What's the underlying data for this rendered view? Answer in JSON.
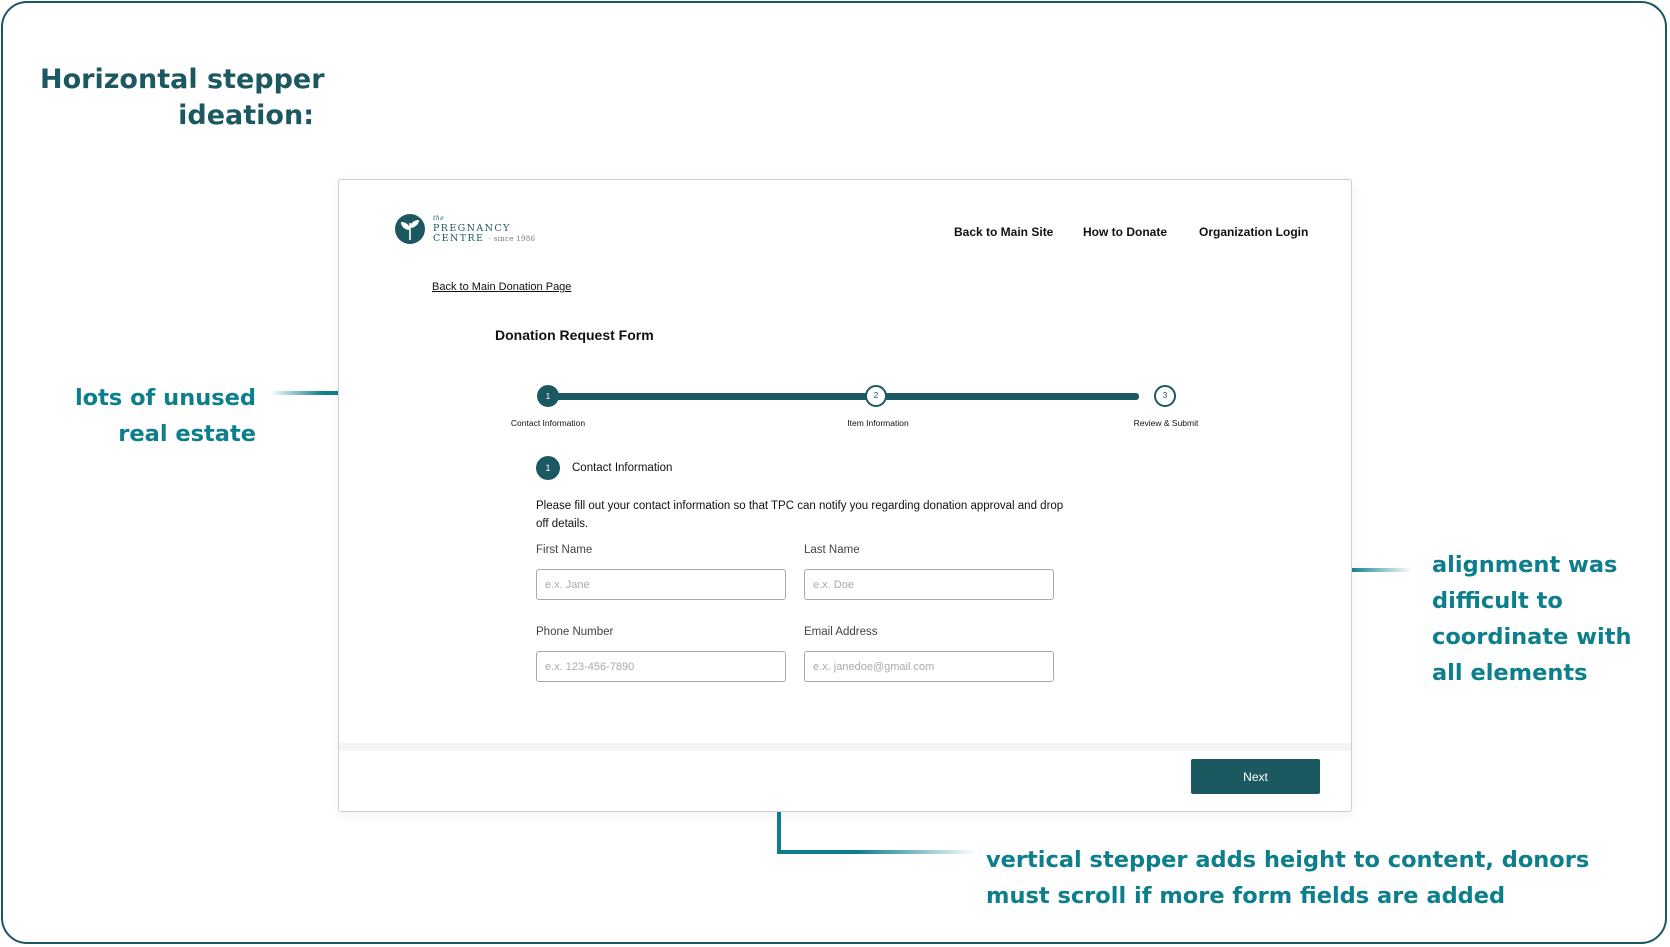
{
  "slide": {
    "title_lines": [
      "Horizontal stepper",
      "ideation:"
    ],
    "annotations": {
      "left": [
        "lots of unused",
        "real estate"
      ],
      "right": [
        "alignment was",
        "difficult to",
        "coordinate with",
        "all elements"
      ],
      "bottom": [
        "vertical stepper adds height to content, donors",
        "must scroll if more form fields are added"
      ]
    },
    "accent_color": "#0d7f8c",
    "title_color": "#1c5860"
  },
  "mockup": {
    "logo": {
      "top": "the",
      "line1": "PREGNANCY",
      "line2": "CENTRE",
      "since": "· since 1986",
      "icon": "leaf-logo-icon"
    },
    "nav": [
      "Back to Main Site",
      "How to Donate",
      "Organization Login"
    ],
    "back_link": "Back to Main Donation Page",
    "form_title": "Donation Request Form",
    "steps": [
      {
        "number": "1",
        "label": "Contact  Information",
        "state": "active"
      },
      {
        "number": "2",
        "label": "Item Information",
        "state": "todo"
      },
      {
        "number": "3",
        "label": "Review & Submit",
        "state": "todo"
      }
    ],
    "section": {
      "number": "1",
      "title": "Contact Information",
      "description": "Please fill out your contact information so that TPC can notify you regarding donation approval and drop off details."
    },
    "fields": {
      "first_name": {
        "label": "First Name",
        "placeholder": "e.x. Jane"
      },
      "last_name": {
        "label": "Last Name",
        "placeholder": "e.x. Doe"
      },
      "phone": {
        "label": "Phone Number",
        "placeholder": "e.x. 123-456-7890"
      },
      "email": {
        "label": "Email Address",
        "placeholder": "e.x. janedoe@gmail.com"
      }
    },
    "next_label": "Next",
    "brand_color": "#1c5860"
  }
}
